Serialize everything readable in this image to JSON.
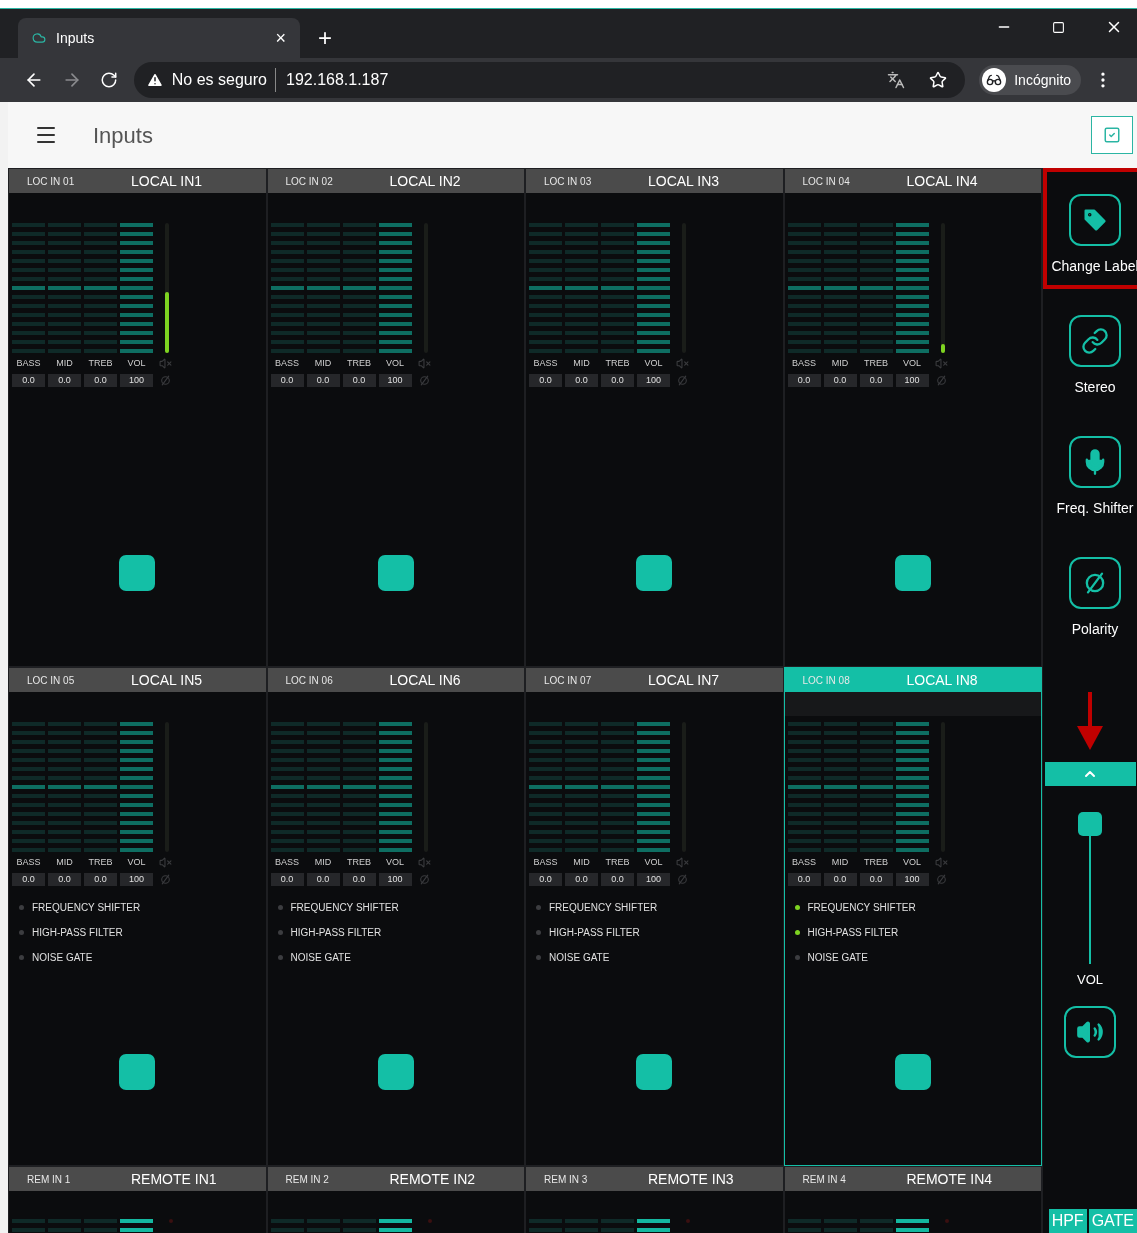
{
  "browser": {
    "tab": {
      "title": "Inputs",
      "close": "×"
    },
    "new_tab": "+",
    "address": {
      "security": "No es seguro",
      "url": "192.168.1.187"
    },
    "profile": "Incógnito"
  },
  "app": {
    "title": "Inputs"
  },
  "channels": [
    {
      "short": "LOC IN 01",
      "name": "LOCAL IN1",
      "selected": false,
      "level": 0.47,
      "bands": [
        {
          "label": "BASS",
          "value": "0.0",
          "kind": "eq"
        },
        {
          "label": "MID",
          "value": "0.0",
          "kind": "eq"
        },
        {
          "label": "TREB",
          "value": "0.0",
          "kind": "eq"
        },
        {
          "label": "VOL",
          "value": "100",
          "kind": "volume"
        }
      ]
    },
    {
      "short": "LOC IN 02",
      "name": "LOCAL IN2",
      "selected": false,
      "level": 0,
      "bands": [
        {
          "label": "BASS",
          "value": "0.0",
          "kind": "eq"
        },
        {
          "label": "MID",
          "value": "0.0",
          "kind": "eq"
        },
        {
          "label": "TREB",
          "value": "0.0",
          "kind": "eq"
        },
        {
          "label": "VOL",
          "value": "100",
          "kind": "volume"
        }
      ]
    },
    {
      "short": "LOC IN 03",
      "name": "LOCAL IN3",
      "selected": false,
      "level": 0,
      "bands": [
        {
          "label": "BASS",
          "value": "0.0",
          "kind": "eq"
        },
        {
          "label": "MID",
          "value": "0.0",
          "kind": "eq"
        },
        {
          "label": "TREB",
          "value": "0.0",
          "kind": "eq"
        },
        {
          "label": "VOL",
          "value": "100",
          "kind": "volume"
        }
      ]
    },
    {
      "short": "LOC IN 04",
      "name": "LOCAL IN4",
      "selected": false,
      "level": 0.07,
      "bands": [
        {
          "label": "BASS",
          "value": "0.0",
          "kind": "eq"
        },
        {
          "label": "MID",
          "value": "0.0",
          "kind": "eq"
        },
        {
          "label": "TREB",
          "value": "0.0",
          "kind": "eq"
        },
        {
          "label": "VOL",
          "value": "100",
          "kind": "volume"
        }
      ]
    },
    {
      "short": "LOC IN 05",
      "name": "LOCAL IN5",
      "selected": false,
      "level": 0,
      "bands": [
        {
          "label": "BASS",
          "value": "0.0",
          "kind": "eq"
        },
        {
          "label": "MID",
          "value": "0.0",
          "kind": "eq"
        },
        {
          "label": "TREB",
          "value": "0.0",
          "kind": "eq"
        },
        {
          "label": "VOL",
          "value": "100",
          "kind": "volume"
        }
      ],
      "effects": [
        {
          "label": "FREQUENCY SHIFTER",
          "on": false
        },
        {
          "label": "HIGH-PASS FILTER",
          "on": false
        },
        {
          "label": "NOISE GATE",
          "on": false
        }
      ]
    },
    {
      "short": "LOC IN 06",
      "name": "LOCAL IN6",
      "selected": false,
      "level": 0,
      "bands": [
        {
          "label": "BASS",
          "value": "0.0",
          "kind": "eq"
        },
        {
          "label": "MID",
          "value": "0.0",
          "kind": "eq"
        },
        {
          "label": "TREB",
          "value": "0.0",
          "kind": "eq"
        },
        {
          "label": "VOL",
          "value": "100",
          "kind": "volume"
        }
      ],
      "effects": [
        {
          "label": "FREQUENCY SHIFTER",
          "on": false
        },
        {
          "label": "HIGH-PASS FILTER",
          "on": false
        },
        {
          "label": "NOISE GATE",
          "on": false
        }
      ]
    },
    {
      "short": "LOC IN 07",
      "name": "LOCAL IN7",
      "selected": false,
      "level": 0,
      "bands": [
        {
          "label": "BASS",
          "value": "0.0",
          "kind": "eq"
        },
        {
          "label": "MID",
          "value": "0.0",
          "kind": "eq"
        },
        {
          "label": "TREB",
          "value": "0.0",
          "kind": "eq"
        },
        {
          "label": "VOL",
          "value": "100",
          "kind": "volume"
        }
      ],
      "effects": [
        {
          "label": "FREQUENCY SHIFTER",
          "on": false
        },
        {
          "label": "HIGH-PASS FILTER",
          "on": false
        },
        {
          "label": "NOISE GATE",
          "on": false
        }
      ]
    },
    {
      "short": "LOC IN 08",
      "name": "LOCAL IN8",
      "selected": true,
      "level": 0,
      "bands": [
        {
          "label": "BASS",
          "value": "0.0",
          "kind": "eq"
        },
        {
          "label": "MID",
          "value": "0.0",
          "kind": "eq"
        },
        {
          "label": "TREB",
          "value": "0.0",
          "kind": "eq"
        },
        {
          "label": "VOL",
          "value": "100",
          "kind": "volume"
        }
      ],
      "effects": [
        {
          "label": "FREQUENCY SHIFTER",
          "on": true
        },
        {
          "label": "HIGH-PASS FILTER",
          "on": true
        },
        {
          "label": "NOISE GATE",
          "on": false
        }
      ]
    }
  ],
  "remote_channels": [
    {
      "short": "REM IN 1",
      "name": "REMOTE IN1",
      "selected": false
    },
    {
      "short": "REM IN 2",
      "name": "REMOTE IN2",
      "selected": false
    },
    {
      "short": "REM IN 3",
      "name": "REMOTE IN3",
      "selected": false
    },
    {
      "short": "REM IN 4",
      "name": "REMOTE IN4",
      "selected": false
    }
  ],
  "sidebar": {
    "actions": [
      {
        "label": "Change Label",
        "kind": "tag",
        "highlighted": true
      },
      {
        "label": "Stereo",
        "kind": "link",
        "highlighted": false
      },
      {
        "label": "Freq. Shifter",
        "kind": "mic",
        "highlighted": false
      },
      {
        "label": "Polarity",
        "kind": "polarity",
        "highlighted": false
      }
    ],
    "volume": {
      "label": "VOL",
      "level": 1
    },
    "badges": [
      "HPF",
      "GATE"
    ]
  }
}
